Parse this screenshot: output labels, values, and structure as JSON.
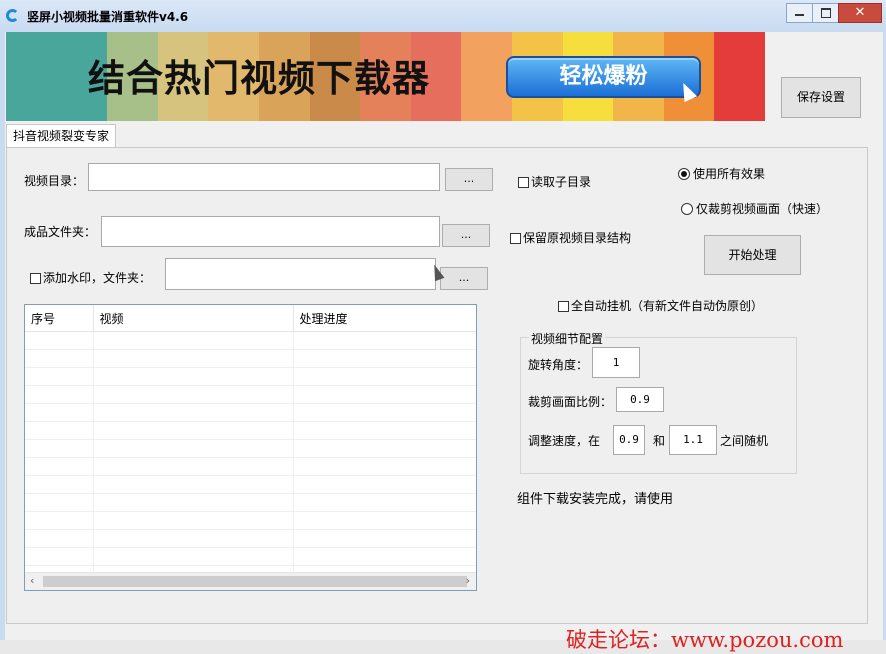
{
  "window": {
    "title": "竖屏小视频批量消重软件v4.6",
    "close_glyph": "✕"
  },
  "banner": {
    "headline": "结合热门视频下载器",
    "button_label": "轻松爆粉",
    "stripe_colors": [
      "#48a79a",
      "#48a79a",
      "#a7c08a",
      "#d6c37e",
      "#e2b96c",
      "#d9a35a",
      "#c98a4a",
      "#e4815b",
      "#e56f5c",
      "#f2a15e",
      "#f4c247",
      "#f6de3c",
      "#f2b54a",
      "#ef8f38",
      "#e43b3b"
    ]
  },
  "toolbar": {
    "save_label": "保存设置"
  },
  "tab": {
    "label": "抖音视频裂变专家"
  },
  "form": {
    "video_dir_label": "视频目录：",
    "output_dir_label": "成品文件夹：",
    "watermark_label": "添加水印，文件夹：",
    "browse_label": "...",
    "read_subdir_label": "读取子目录",
    "keep_structure_label": "保留原视频目录结构",
    "all_effects_label": "使用所有效果",
    "crop_only_label": "仅裁剪视频画面（快速）",
    "start_label": "开始处理",
    "auto_hang_label": "全自动挂机（有新文件自动伪原创）"
  },
  "table": {
    "headers": [
      "序号",
      "视频",
      "处理进度"
    ],
    "left_arrow": "‹",
    "right_arrow": "›"
  },
  "config": {
    "title": "视频细节配置",
    "rotate_label": "旋转角度：",
    "rotate_value": "1",
    "crop_ratio_label": "裁剪画面比例：",
    "crop_ratio_value": "0.9",
    "speed_label": "调整速度，在",
    "speed_min": "0.9",
    "and_label": "和",
    "speed_max": "1.1",
    "random_label": "之间随机"
  },
  "status": {
    "message": "组件下载安装完成，请使用"
  },
  "watermark": {
    "text": "破走论坛：www.pozou.com"
  }
}
